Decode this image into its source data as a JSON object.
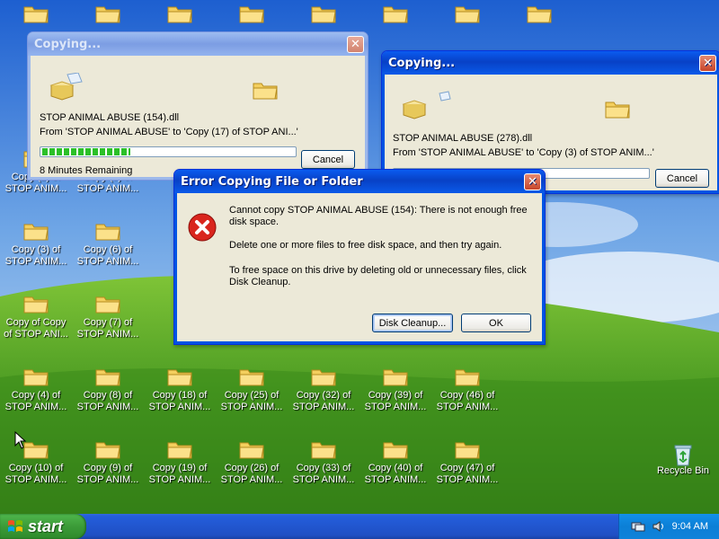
{
  "desktop": {
    "icons": [
      {
        "label": "",
        "col": 0,
        "row": 0
      },
      {
        "label": "",
        "col": 1,
        "row": 0
      },
      {
        "label": "",
        "col": 2,
        "row": 0
      },
      {
        "label": "",
        "col": 3,
        "row": 0
      },
      {
        "label": "",
        "col": 4,
        "row": 0
      },
      {
        "label": "",
        "col": 5,
        "row": 0
      },
      {
        "label": "",
        "col": 6,
        "row": 0
      },
      {
        "label": "",
        "col": 7,
        "row": 0
      },
      {
        "label": "Copy (2) of\nSTOP ANIM...",
        "col": 0,
        "row": 2
      },
      {
        "label": "Copy (5) of\nSTOP ANIM...",
        "col": 1,
        "row": 2
      },
      {
        "label": "Copy (3) of\nSTOP ANIM...",
        "col": 0,
        "row": 3
      },
      {
        "label": "Copy (6) of\nSTOP ANIM...",
        "col": 1,
        "row": 3
      },
      {
        "label": "Copy of Copy\nof STOP ANI...",
        "col": 0,
        "row": 4
      },
      {
        "label": "Copy (7) of\nSTOP ANIM...",
        "col": 1,
        "row": 4
      },
      {
        "label": "Copy (4) of\nSTOP ANIM...",
        "col": 0,
        "row": 5
      },
      {
        "label": "Copy (8) of\nSTOP ANIM...",
        "col": 1,
        "row": 5
      },
      {
        "label": "Copy (18) of\nSTOP ANIM...",
        "col": 2,
        "row": 5
      },
      {
        "label": "Copy (25) of\nSTOP ANIM...",
        "col": 3,
        "row": 5
      },
      {
        "label": "Copy (32) of\nSTOP ANIM...",
        "col": 4,
        "row": 5
      },
      {
        "label": "Copy (39) of\nSTOP ANIM...",
        "col": 5,
        "row": 5
      },
      {
        "label": "Copy (46) of\nSTOP ANIM...",
        "col": 6,
        "row": 5
      },
      {
        "label": "Copy (10) of\nSTOP ANIM...",
        "col": 0,
        "row": 6
      },
      {
        "label": "Copy (9) of\nSTOP ANIM...",
        "col": 1,
        "row": 6
      },
      {
        "label": "Copy (19) of\nSTOP ANIM...",
        "col": 2,
        "row": 6
      },
      {
        "label": "Copy (26) of\nSTOP ANIM...",
        "col": 3,
        "row": 6
      },
      {
        "label": "Copy (33) of\nSTOP ANIM...",
        "col": 4,
        "row": 6
      },
      {
        "label": "Copy (40) of\nSTOP ANIM...",
        "col": 5,
        "row": 6
      },
      {
        "label": "Copy (47) of\nSTOP ANIM...",
        "col": 6,
        "row": 6
      }
    ],
    "recycle_bin_label": "Recycle Bin"
  },
  "copy_window_1": {
    "title": "Copying...",
    "filename": "STOP ANIMAL ABUSE (154).dll",
    "from_to": "From 'STOP ANIMAL ABUSE' to 'Copy (17) of STOP ANI...'",
    "progress_percent": 35,
    "remaining": "8 Minutes Remaining",
    "cancel_label": "Cancel"
  },
  "copy_window_2": {
    "title": "Copying...",
    "filename": "STOP ANIMAL ABUSE (278).dll",
    "from_to": "From 'STOP ANIMAL ABUSE' to 'Copy (3) of STOP ANIM...'",
    "progress_percent": 0,
    "cancel_label": "Cancel"
  },
  "error_dialog": {
    "title": "Error Copying File or Folder",
    "message_line1": "Cannot copy STOP ANIMAL ABUSE (154): There is not enough free",
    "message_line2": "disk space.",
    "message_line3": "Delete one or more files to free disk space, and then try again.",
    "message_line4": "To free space on this drive by deleting old or unnecessary files, click",
    "message_line5": "Disk Cleanup.",
    "disk_cleanup_label": "Disk Cleanup...",
    "ok_label": "OK"
  },
  "taskbar": {
    "start_label": "start",
    "clock": "9:04 AM"
  },
  "colors": {
    "title_active": "#0a5bf0",
    "start_green": "#3c9b38",
    "error_red": "#d9251d"
  }
}
